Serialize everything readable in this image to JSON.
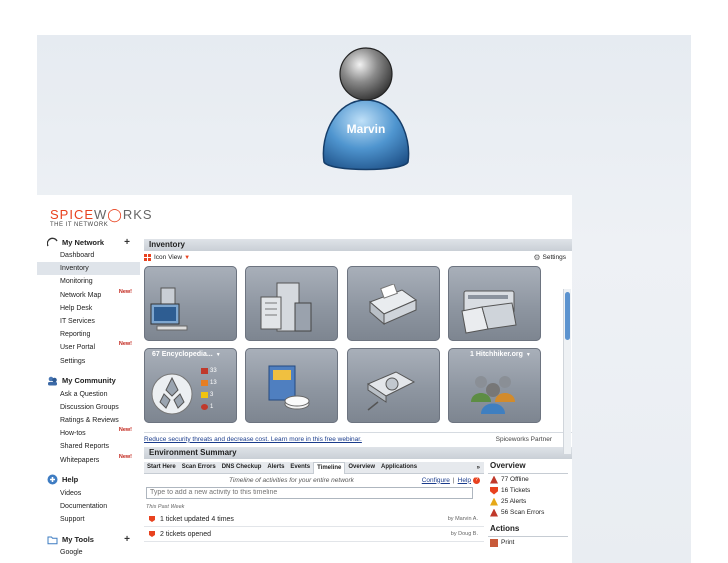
{
  "avatar": {
    "name": "Marvin"
  },
  "app": {
    "logo": {
      "brand_a": "SPICE",
      "brand_b": "W",
      "brand_c": "RKS",
      "tagline": "THE IT NETWORK"
    },
    "sidebar": {
      "my_network": {
        "title": "My Network",
        "items": [
          {
            "label": "Dashboard"
          },
          {
            "label": "Inventory",
            "active": true
          },
          {
            "label": "Monitoring"
          },
          {
            "label": "Network Map",
            "badge": "New!"
          },
          {
            "label": "Help Desk"
          },
          {
            "label": "IT Services"
          },
          {
            "label": "Reporting"
          },
          {
            "label": "User Portal",
            "badge": "New!"
          },
          {
            "label": "Settings"
          }
        ]
      },
      "my_community": {
        "title": "My Community",
        "items": [
          {
            "label": "Ask a Question"
          },
          {
            "label": "Discussion Groups"
          },
          {
            "label": "Ratings & Reviews"
          },
          {
            "label": "How-tos",
            "badge": "New!"
          },
          {
            "label": "Shared Reports"
          },
          {
            "label": "Whitepapers",
            "badge": "New!"
          }
        ]
      },
      "help": {
        "title": "Help",
        "items": [
          {
            "label": "Videos"
          },
          {
            "label": "Documentation"
          },
          {
            "label": "Support"
          }
        ]
      },
      "my_tools": {
        "title": "My Tools",
        "items": [
          {
            "label": "Google"
          }
        ]
      }
    },
    "inventory": {
      "title": "Inventory",
      "view_label": "Icon View",
      "settings_label": "Settings",
      "tiles": [
        {
          "icon": "workstation-icon"
        },
        {
          "icon": "server-icon"
        },
        {
          "icon": "printer-icon"
        },
        {
          "icon": "phone-icon"
        },
        {
          "icon": "encyclopedia-icon",
          "title": "67 Encyclopedia...",
          "stats": [
            "33",
            "13",
            "3",
            "1"
          ]
        },
        {
          "icon": "software-icon"
        },
        {
          "icon": "scanner-icon"
        },
        {
          "icon": "users-icon",
          "title": "1 Hitchhiker.org"
        }
      ],
      "promo_text": "Reduce security threats and decrease cost. Learn more in this free webinar.",
      "partner_label": "Spiceworks Partner"
    },
    "environment": {
      "title": "Environment Summary",
      "tabs": [
        "Start Here",
        "Scan Errors",
        "DNS Checkup",
        "Alerts",
        "Events",
        "Timeline",
        "Overview",
        "Applications"
      ],
      "active_tab": "Timeline",
      "more": "»",
      "timeline_caption": "Timeline of activities for your entire network",
      "configure": "Configure",
      "help": "Help",
      "input_placeholder": "Type to add a new activity to this timeline",
      "week_label": "This Past Week",
      "activities": [
        {
          "text": "1 ticket updated 4 times",
          "by": "by Marvin A."
        },
        {
          "text": "2 tickets opened",
          "by": "by Doug B."
        }
      ],
      "overview": {
        "title": "Overview",
        "items": [
          {
            "label": "77 Offline",
            "icon": "offline-icon"
          },
          {
            "label": "16 Tickets",
            "icon": "ticket-icon"
          },
          {
            "label": "25 Alerts",
            "icon": "alert-icon"
          },
          {
            "label": "56 Scan Errors",
            "icon": "scan-error-icon"
          }
        ]
      },
      "actions": {
        "title": "Actions",
        "items": [
          {
            "label": "Print",
            "icon": "print-icon"
          }
        ]
      }
    }
  }
}
